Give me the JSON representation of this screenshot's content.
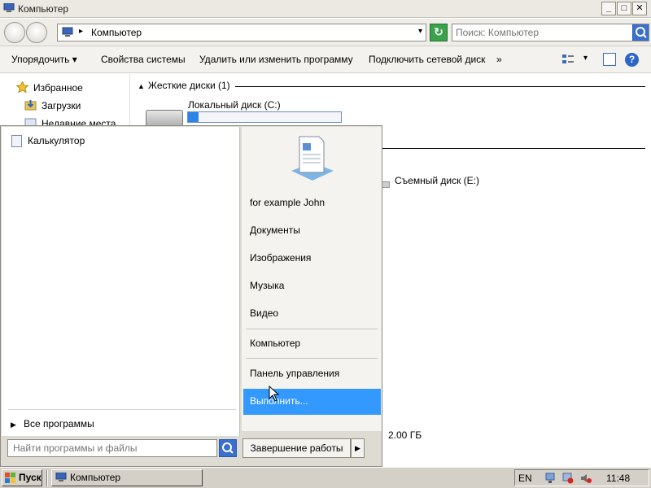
{
  "window": {
    "title": "Компьютер",
    "buttons": {
      "minimize": "_",
      "maximize": "□",
      "close": "✕"
    }
  },
  "navbar": {
    "address": "Компьютер",
    "search_placeholder": "Поиск: Компьютер"
  },
  "toolbar": {
    "organize": "Упорядочить ▾",
    "system_properties": "Свойства системы",
    "uninstall": "Удалить или изменить программу",
    "map_drive": "Подключить сетевой диск",
    "more": "»"
  },
  "navpane": {
    "favorites": "Избранное",
    "downloads": "Загрузки",
    "recent": "Недавние места"
  },
  "content": {
    "hard_disks_header": "Жесткие диски (1)",
    "local_disk": "Локальный диск (C:)",
    "local_disk_usage_fraction": 0.07,
    "removable_disk": "Съемный диск (E:)",
    "free_info": "2.00 ГБ"
  },
  "start_menu": {
    "recent_program": "Калькулятор",
    "all_programs": "Все программы",
    "search_placeholder": "Найти программы и файлы",
    "right_items": [
      "for example John",
      "Документы",
      "Изображения",
      "Музыка",
      "Видео",
      "Компьютер",
      "Панель управления",
      "Выполнить..."
    ],
    "shutdown": "Завершение работы"
  },
  "taskbar": {
    "start": "Пуск",
    "task_title": "Компьютер",
    "language": "EN",
    "time": "11:48"
  },
  "colors": {
    "highlight": "#3399ff",
    "accent": "#2b84e6"
  }
}
